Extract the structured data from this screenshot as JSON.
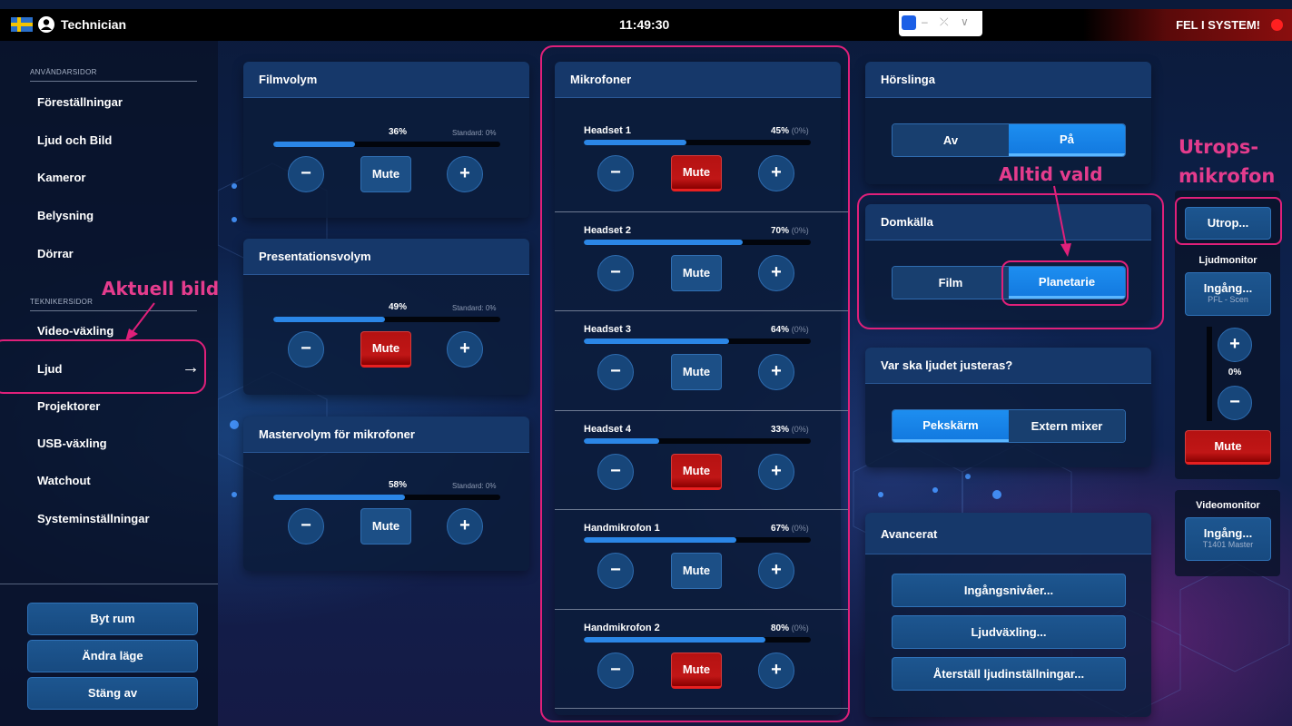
{
  "topbar": {
    "user": "Technician",
    "clock": "11:49:30",
    "error": "FEL I SYSTEM!",
    "tv_controls": [
      "–",
      "⤫",
      "∨"
    ]
  },
  "sidebar": {
    "section_user": "ANVÄNDARSIDOR",
    "user_items": [
      "Föreställningar",
      "Ljud och Bild",
      "Kameror",
      "Belysning",
      "Dörrar"
    ],
    "section_tech": "TEKNIKERSIDOR",
    "tech_items": [
      "Video-växling",
      "Ljud",
      "Projektorer",
      "USB-växling",
      "Watchout",
      "Systeminställningar"
    ],
    "active_arrow": "→",
    "buttons": [
      "Byt rum",
      "Ändra läge",
      "Stäng av"
    ]
  },
  "filmvolym": {
    "title": "Filmvolym",
    "pct": "36%",
    "level": 0.36,
    "standard": "Standard: 0%",
    "mute": "Mute",
    "muted": false
  },
  "presentation": {
    "title": "Presentationsvolym",
    "pct": "49%",
    "level": 0.49,
    "standard": "Standard: 0%",
    "mute": "Mute",
    "muted": true
  },
  "master": {
    "title": "Mastervolym för mikrofoner",
    "pct": "58%",
    "level": 0.58,
    "standard": "Standard: 0%",
    "mute": "Mute",
    "muted": false
  },
  "controls": {
    "minus": "−",
    "plus": "+"
  },
  "mikrofoner": {
    "title": "Mikrofoner",
    "items": [
      {
        "name": "Headset 1",
        "pct": "45%",
        "sub": "(0%)",
        "level": 0.45,
        "mute": "Mute",
        "muted": true
      },
      {
        "name": "Headset 2",
        "pct": "70%",
        "sub": "(0%)",
        "level": 0.7,
        "mute": "Mute",
        "muted": false
      },
      {
        "name": "Headset 3",
        "pct": "64%",
        "sub": "(0%)",
        "level": 0.64,
        "mute": "Mute",
        "muted": false
      },
      {
        "name": "Headset 4",
        "pct": "33%",
        "sub": "(0%)",
        "level": 0.33,
        "mute": "Mute",
        "muted": true
      },
      {
        "name": "Handmikrofon 1",
        "pct": "67%",
        "sub": "(0%)",
        "level": 0.67,
        "mute": "Mute",
        "muted": false
      },
      {
        "name": "Handmikrofon 2",
        "pct": "80%",
        "sub": "(0%)",
        "level": 0.8,
        "mute": "Mute",
        "muted": true
      }
    ]
  },
  "horslinga": {
    "title": "Hörslinga",
    "options": [
      "Av",
      "På"
    ],
    "selected": 1
  },
  "domkalla": {
    "title": "Domkälla",
    "options": [
      "Film",
      "Planetarie"
    ],
    "selected": 1
  },
  "justeras": {
    "title": "Var ska ljudet justeras?",
    "options": [
      "Pekskärm",
      "Extern mixer"
    ],
    "selected": 0
  },
  "avancerat": {
    "title": "Avancerat",
    "buttons": [
      "Ingångsnivåer...",
      "Ljudväxling...",
      "Återställ ljudinställningar..."
    ]
  },
  "right": {
    "utrop": "Utrop...",
    "ljudmonitor_title": "Ljudmonitor",
    "ljudmonitor_btn": "Ingång...",
    "ljudmonitor_sub": "PFL - Scen",
    "monitor_pct": "0%",
    "monitor_level": 0.0,
    "monitor_mute": "Mute",
    "videomonitor_title": "Videomonitor",
    "videomonitor_btn": "Ingång...",
    "videomonitor_sub": "T1401 Master"
  },
  "annotations": {
    "aktuell_bild": "Aktuell bild",
    "alltid_vald": "Alltid vald",
    "utrops_1": "Utrops-",
    "utrops_2": "mikrofon"
  },
  "colors": {
    "accent": "#2b86e6",
    "mute_active": "#c01616",
    "annotation": "#e0207a",
    "error": "#ff2020"
  }
}
